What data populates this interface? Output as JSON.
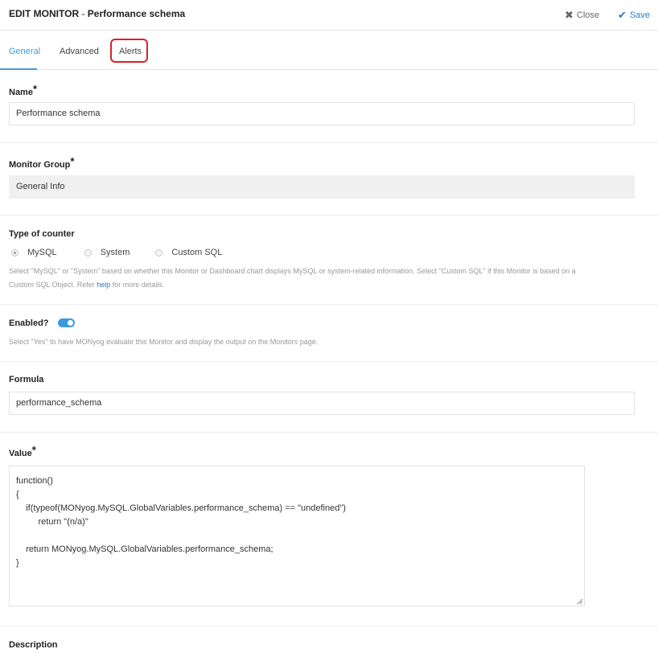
{
  "header": {
    "title_prefix": "EDIT MONITOR",
    "separator": " - ",
    "title_name": "Performance schema",
    "close_label": "Close",
    "save_label": "Save"
  },
  "tabs": [
    {
      "label": "General",
      "active": true
    },
    {
      "label": "Advanced",
      "active": false
    },
    {
      "label": "Alerts",
      "active": false
    }
  ],
  "name_section": {
    "label": "Name",
    "required": "*",
    "value": "Performance schema"
  },
  "group_section": {
    "label": "Monitor Group",
    "required": "*",
    "value": "General Info"
  },
  "counter_section": {
    "label": "Type of counter",
    "options": [
      {
        "label": "MySQL",
        "checked": true
      },
      {
        "label": "System",
        "checked": false
      },
      {
        "label": "Custom SQL",
        "checked": false
      }
    ],
    "help_line1": "Select \"MySQL\" or \"System\" based on whether this Monitor or Dashboard chart displays MySQL or system-related information. Select \"Custom SQL\" if this Monitor is based on a",
    "help_line2_prefix": "Custom SQL Object. Refer ",
    "help_link": "help",
    "help_line2_suffix": " for more details."
  },
  "enabled_section": {
    "label": "Enabled?",
    "enabled": true,
    "help": "Select \"Yes\" to have MONyog evaluate this Monitor and display the output on the Monitors page."
  },
  "formula_section": {
    "label": "Formula",
    "value": "performance_schema"
  },
  "value_section": {
    "label": "Value",
    "required": "*",
    "code": [
      "function()",
      "{",
      "    if(typeof(MONyog.MySQL.GlobalVariables.performance_schema) == \"undefined\")",
      "         return \"(n/a)\"",
      "",
      "    return MONyog.MySQL.GlobalVariables.performance_schema;",
      "}"
    ]
  },
  "description_section": {
    "label": "Description"
  },
  "colors": {
    "accent": "#3c9be0",
    "highlight": "#d9222a",
    "link": "#2a7bc8"
  },
  "icons": {
    "close": "close-icon",
    "save": "checkmark-icon"
  }
}
